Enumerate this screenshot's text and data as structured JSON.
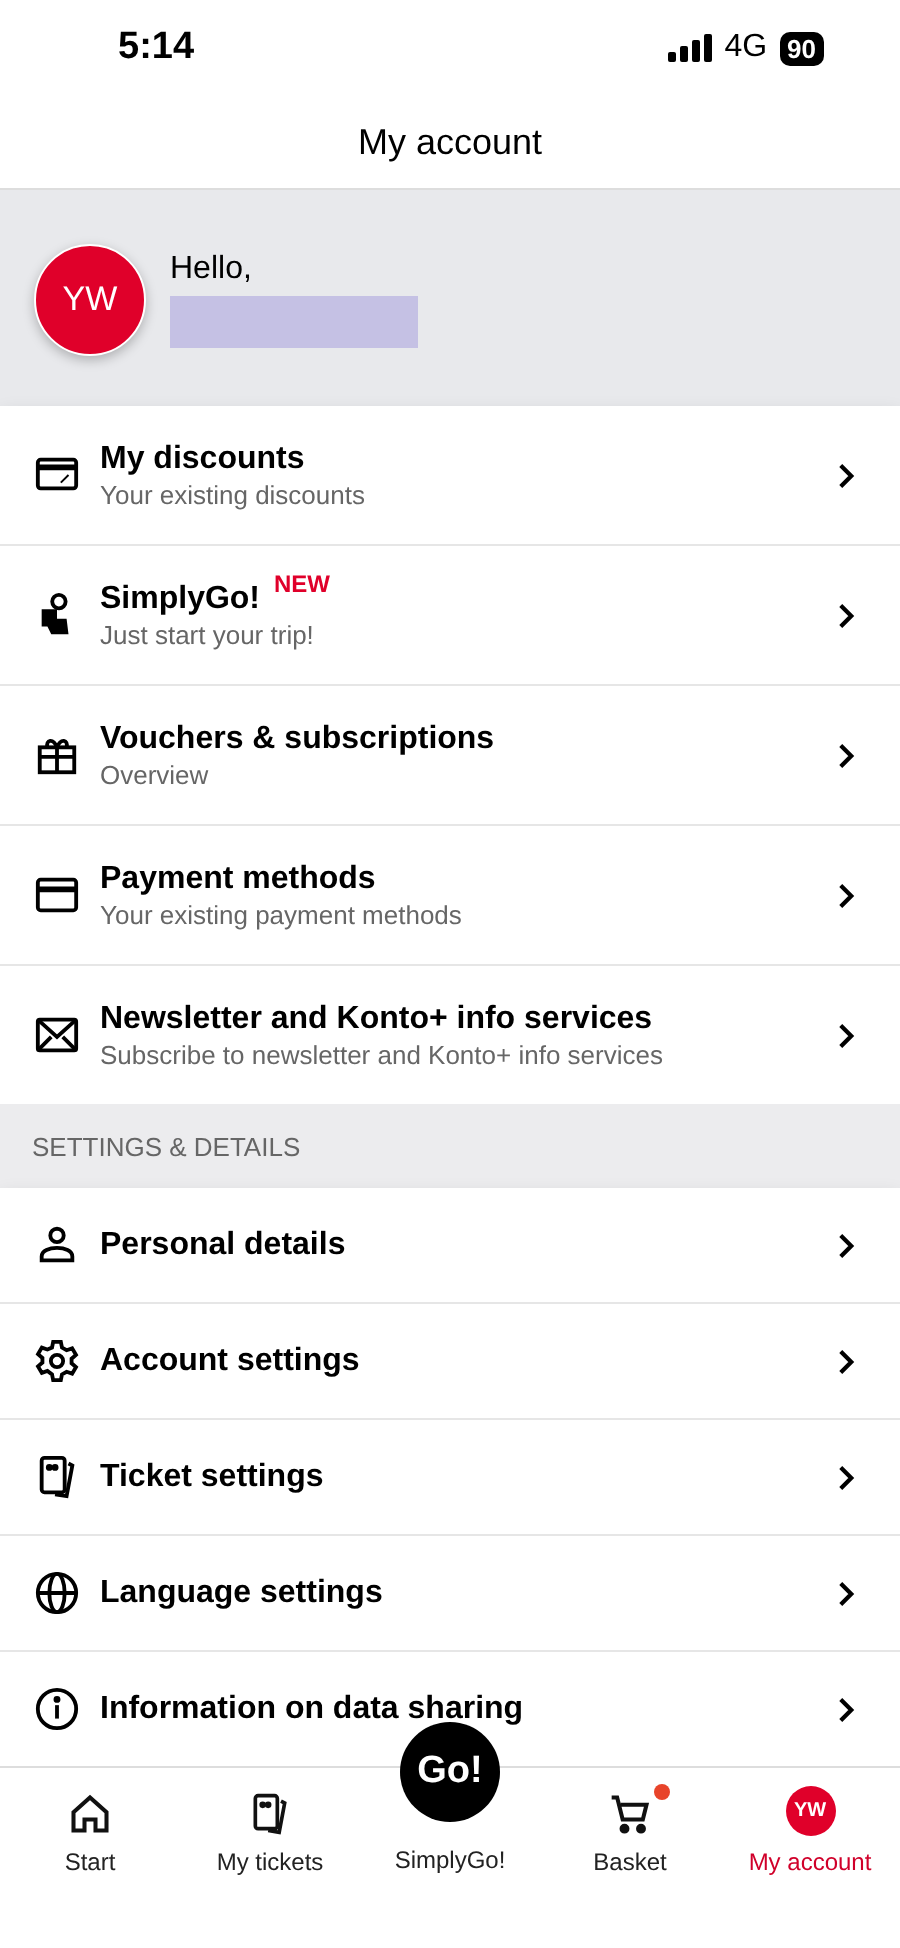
{
  "status_bar": {
    "time": "5:14",
    "network": "4G",
    "battery": "90"
  },
  "header": {
    "title": "My account"
  },
  "profile": {
    "initials": "YW",
    "greeting": "Hello,"
  },
  "account_items": [
    {
      "title": "My discounts",
      "subtitle": "Your existing discounts"
    },
    {
      "title": "SimplyGo!",
      "badge": "NEW",
      "subtitle": "Just start your trip!"
    },
    {
      "title": "Vouchers & subscriptions",
      "subtitle": "Overview"
    },
    {
      "title": "Payment methods",
      "subtitle": "Your existing payment methods"
    },
    {
      "title": "Newsletter and Konto+ info services",
      "subtitle": "Subscribe to newsletter and Konto+ info services"
    }
  ],
  "settings_section": {
    "heading": "SETTINGS & DETAILS",
    "items": [
      {
        "title": "Personal details"
      },
      {
        "title": "Account settings"
      },
      {
        "title": "Ticket settings"
      },
      {
        "title": "Language settings"
      },
      {
        "title": "Information on data sharing"
      }
    ]
  },
  "tab_bar": [
    {
      "kind": "home",
      "label": "Start",
      "selected": false,
      "notification": false
    },
    {
      "kind": "tickets",
      "label": "My tickets",
      "selected": false,
      "notification": false
    },
    {
      "kind": "go",
      "label": "SimplyGo!",
      "button_text": "Go!",
      "selected": false,
      "notification": false
    },
    {
      "kind": "cart",
      "label": "Basket",
      "selected": false,
      "notification": true
    },
    {
      "kind": "avatar",
      "label": "My account",
      "avatar_text": "YW",
      "selected": true,
      "notification": false
    }
  ]
}
